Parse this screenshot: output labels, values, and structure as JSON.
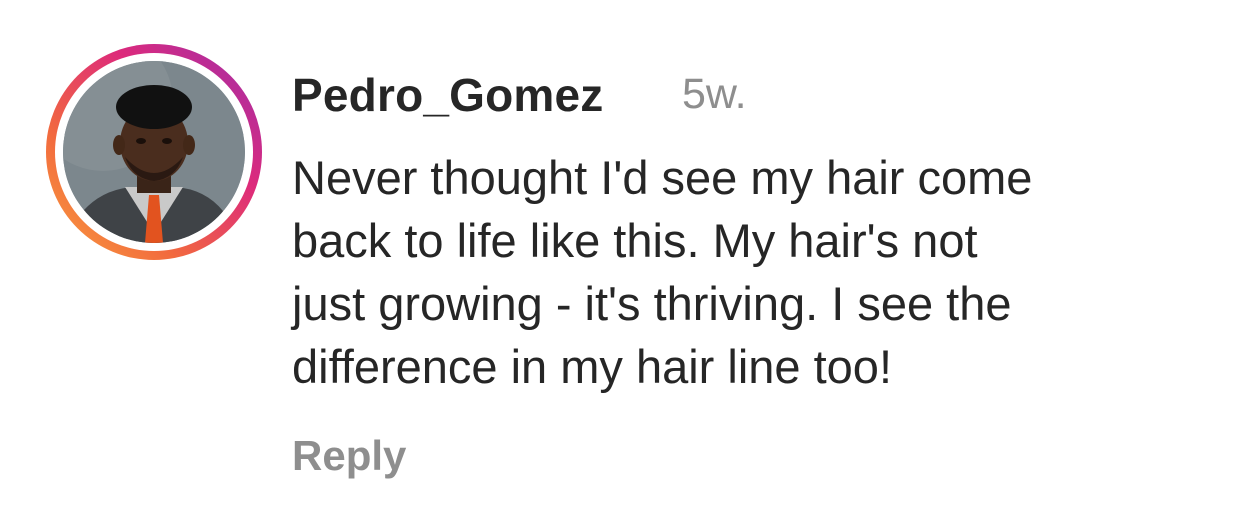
{
  "comment": {
    "username": "Pedro_Gomez",
    "time": "5w.",
    "lines": [
      "Never thought I'd see my hair come",
      "back to life like this. My hair's not",
      "just growing - it's thriving. I see the",
      "difference in my hair line too!"
    ],
    "reply_label": "Reply"
  },
  "colors": {
    "username": "#262626",
    "secondary_text": "#8e8e8e",
    "story_ring_start": "#f9a03f",
    "story_ring_end": "#9b2fae"
  }
}
